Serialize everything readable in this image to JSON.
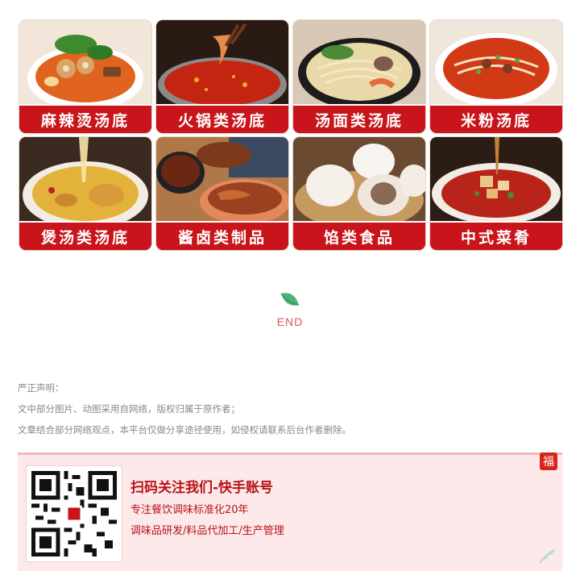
{
  "categories": [
    {
      "label": "麻辣烫汤底",
      "icon": "malatang-photo"
    },
    {
      "label": "火锅类汤底",
      "icon": "hotpot-photo"
    },
    {
      "label": "汤面类汤底",
      "icon": "noodle-soup-photo"
    },
    {
      "label": "米粉汤底",
      "icon": "rice-noodle-photo"
    },
    {
      "label": "煲汤类汤底",
      "icon": "stew-soup-photo"
    },
    {
      "label": "酱卤类制品",
      "icon": "braised-meat-photo"
    },
    {
      "label": "馅类食品",
      "icon": "buns-photo"
    },
    {
      "label": "中式菜肴",
      "icon": "chinese-dish-photo"
    }
  ],
  "end": {
    "text": "END"
  },
  "statement": {
    "heading": "严正声明：",
    "line1": "文中部分图片、动图采用自网络，版权归属于原作者；",
    "line2": "文章结合部分网络观点，本平台仅做分享途径使用，如侵权请联系后台作者删除。"
  },
  "follow_card": {
    "title": "扫码关注我们-快手账号",
    "line1": "专注餐饮调味标准化20年",
    "line2": "调味品研发/料品代加工/生产管理",
    "seal_char": "福"
  },
  "colors": {
    "brand_red": "#c8141a",
    "card_bg": "#fde9e9",
    "end_text": "#d35a5a"
  }
}
